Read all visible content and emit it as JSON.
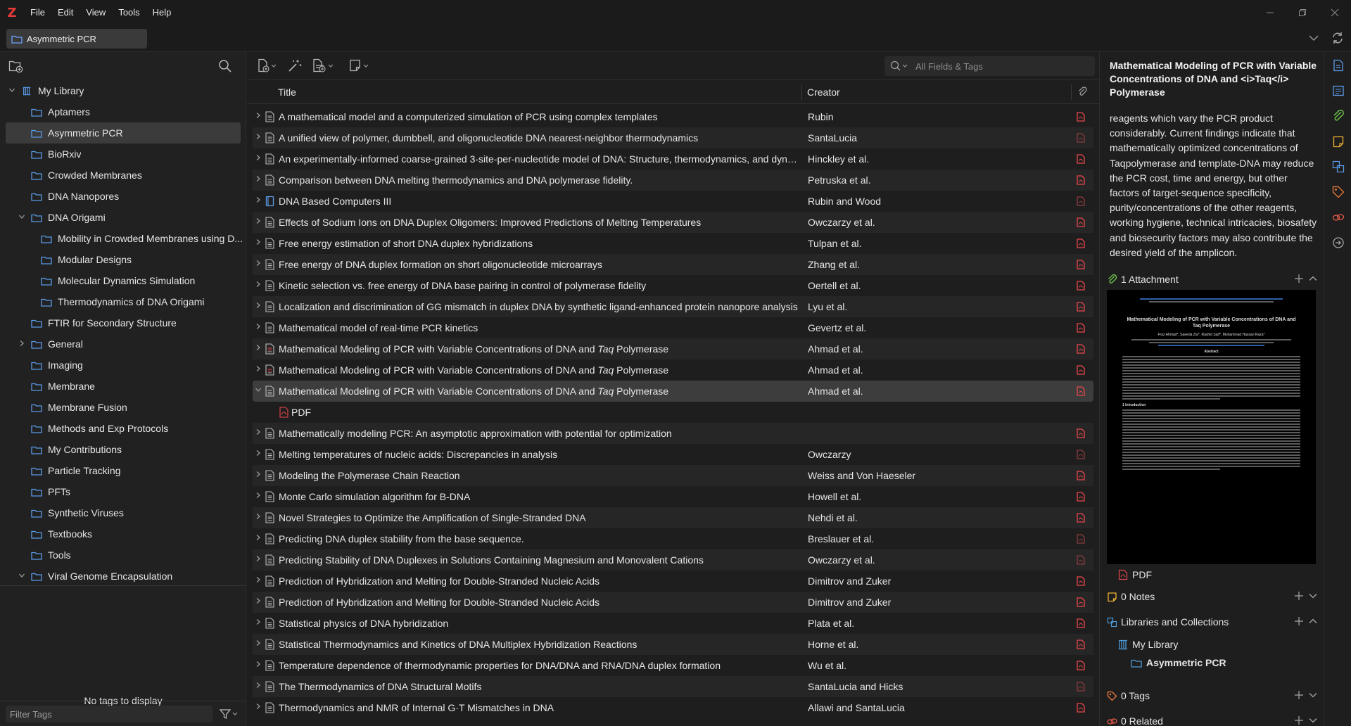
{
  "app": {
    "logo_letter": "Z",
    "accent": "#e83a3a"
  },
  "menu": [
    "File",
    "Edit",
    "View",
    "Tools",
    "Help"
  ],
  "tab": {
    "label": "Asymmetric PCR"
  },
  "collections": [
    {
      "label": "My Library",
      "level": 0,
      "twisty": "open",
      "type": "library"
    },
    {
      "label": "Aptamers",
      "level": 1,
      "twisty": "",
      "type": "folder"
    },
    {
      "label": "Asymmetric PCR",
      "level": 1,
      "twisty": "",
      "type": "folder",
      "selected": true
    },
    {
      "label": "BioRxiv",
      "level": 1,
      "twisty": "",
      "type": "folder"
    },
    {
      "label": "Crowded Membranes",
      "level": 1,
      "twisty": "",
      "type": "folder"
    },
    {
      "label": "DNA Nanopores",
      "level": 1,
      "twisty": "",
      "type": "folder"
    },
    {
      "label": "DNA Origami",
      "level": 1,
      "twisty": "open",
      "type": "folder"
    },
    {
      "label": "Mobility in Crowded Membranes using D...",
      "level": 2,
      "twisty": "",
      "type": "folder"
    },
    {
      "label": "Modular Designs",
      "level": 2,
      "twisty": "",
      "type": "folder"
    },
    {
      "label": "Molecular Dynamics Simulation",
      "level": 2,
      "twisty": "",
      "type": "folder"
    },
    {
      "label": "Thermodynamics of DNA Origami",
      "level": 2,
      "twisty": "",
      "type": "folder"
    },
    {
      "label": "FTIR for Secondary Structure",
      "level": 1,
      "twisty": "",
      "type": "folder"
    },
    {
      "label": "General",
      "level": 1,
      "twisty": "closed",
      "type": "folder"
    },
    {
      "label": "Imaging",
      "level": 1,
      "twisty": "",
      "type": "folder"
    },
    {
      "label": "Membrane",
      "level": 1,
      "twisty": "",
      "type": "folder"
    },
    {
      "label": "Membrane Fusion",
      "level": 1,
      "twisty": "",
      "type": "folder"
    },
    {
      "label": "Methods and Exp Protocols",
      "level": 1,
      "twisty": "",
      "type": "folder"
    },
    {
      "label": "My Contributions",
      "level": 1,
      "twisty": "",
      "type": "folder"
    },
    {
      "label": "Particle Tracking",
      "level": 1,
      "twisty": "",
      "type": "folder"
    },
    {
      "label": "PFTs",
      "level": 1,
      "twisty": "",
      "type": "folder"
    },
    {
      "label": "Synthetic Viruses",
      "level": 1,
      "twisty": "",
      "type": "folder"
    },
    {
      "label": "Textbooks",
      "level": 1,
      "twisty": "",
      "type": "folder"
    },
    {
      "label": "Tools",
      "level": 1,
      "twisty": "",
      "type": "folder"
    },
    {
      "label": "Viral Genome Encapsulation",
      "level": 1,
      "twisty": "open",
      "type": "folder"
    }
  ],
  "tags": {
    "empty_text": "No tags to display",
    "filter_placeholder": "Filter Tags"
  },
  "search": {
    "placeholder": "All Fields & Tags"
  },
  "columns": {
    "title": "Title",
    "creator": "Creator"
  },
  "items": [
    {
      "title": "A mathematical model and a computerized simulation of PCR using complex templates",
      "creator": "Rubin",
      "icon": "doc",
      "attach": "pdf"
    },
    {
      "title": "A unified view of polymer, dumbbell, and oligonucleotide DNA nearest-neighbor thermodynamics",
      "creator": "SantaLucia",
      "icon": "doc",
      "attach": "pdf-dim"
    },
    {
      "title": "An experimentally-informed coarse-grained 3-site-per-nucleotide model of DNA: Structure, thermodynamics, and dyna...",
      "creator": "Hinckley et al.",
      "icon": "doc",
      "attach": "pdf"
    },
    {
      "title": "Comparison between DNA melting thermodynamics and DNA polymerase fidelity.",
      "creator": "Petruska et al.",
      "icon": "doc",
      "attach": "pdf"
    },
    {
      "title": "DNA Based Computers III",
      "creator": "Rubin and Wood",
      "icon": "book",
      "attach": "pdf-dim"
    },
    {
      "title": "Effects of Sodium Ions on DNA Duplex Oligomers: Improved Predictions of Melting Temperatures",
      "creator": "Owczarzy et al.",
      "icon": "doc",
      "attach": "pdf"
    },
    {
      "title": "Free energy estimation of short DNA duplex hybridizations",
      "creator": "Tulpan et al.",
      "icon": "doc",
      "attach": "pdf"
    },
    {
      "title": "Free energy of DNA duplex formation on short oligonucleotide microarrays",
      "creator": "Zhang et al.",
      "icon": "doc",
      "attach": "pdf"
    },
    {
      "title": "Kinetic selection vs. free energy of DNA base pairing in control of polymerase fidelity",
      "creator": "Oertell et al.",
      "icon": "doc",
      "attach": "pdf"
    },
    {
      "title": "Localization and discrimination of GG mismatch in duplex DNA by synthetic ligand-enhanced protein nanopore analysis",
      "creator": "Lyu et al.",
      "icon": "doc",
      "attach": "pdf"
    },
    {
      "title": "Mathematical model of real-time PCR kinetics",
      "creator": "Gevertz et al.",
      "icon": "doc",
      "attach": "pdf"
    },
    {
      "title_pre": "Mathematical Modeling of PCR with Variable Concentrations of DNA and ",
      "title_em": "Taq",
      "title_post": " Polymerase",
      "creator": "Ahmad et al.",
      "icon": "preprint",
      "attach": "pdf"
    },
    {
      "title_pre": "Mathematical Modeling of PCR with Variable Concentrations of DNA and ",
      "title_em": "Taq",
      "title_post": " Polymerase",
      "creator": "Ahmad et al.",
      "icon": "preprint",
      "attach": "pdf"
    },
    {
      "title_pre": "Mathematical Modeling of PCR with Variable Concentrations of DNA and ",
      "title_em": "Taq",
      "title_post": " Polymerase",
      "creator": "Ahmad et al.",
      "icon": "doc",
      "attach": "pdf",
      "selected": true,
      "open": true
    },
    {
      "title": "PDF",
      "creator": "",
      "icon": "pdf",
      "attach": "",
      "child": true
    },
    {
      "title": "Mathematically modeling PCR: An asymptotic approximation with potential for optimization",
      "creator": "",
      "icon": "doc",
      "attach": "pdf"
    },
    {
      "title": "Melting temperatures of nucleic acids: Discrepancies in analysis",
      "creator": "Owczarzy",
      "icon": "doc",
      "attach": "pdf-dim"
    },
    {
      "title": "Modeling the Polymerase Chain Reaction",
      "creator": "Weiss and Von Haeseler",
      "icon": "doc",
      "attach": "pdf"
    },
    {
      "title": "Monte Carlo simulation algorithm for B-DNA",
      "creator": "Howell et al.",
      "icon": "doc",
      "attach": "pdf"
    },
    {
      "title": "Novel Strategies to Optimize the Amplification of Single-Stranded DNA",
      "creator": "Nehdi et al.",
      "icon": "doc",
      "attach": "pdf"
    },
    {
      "title": "Predicting DNA duplex stability from the base sequence.",
      "creator": "Breslauer et al.",
      "icon": "doc",
      "attach": "pdf-dim"
    },
    {
      "title": "Predicting Stability of DNA Duplexes in Solutions Containing Magnesium and Monovalent Cations",
      "creator": "Owczarzy et al.",
      "icon": "doc",
      "attach": "pdf-dim"
    },
    {
      "title": "Prediction of Hybridization and Melting for Double-Stranded Nucleic Acids",
      "creator": "Dimitrov and Zuker",
      "icon": "doc",
      "attach": "pdf"
    },
    {
      "title": "Prediction of Hybridization and Melting for Double-Stranded Nucleic Acids",
      "creator": "Dimitrov and Zuker",
      "icon": "doc",
      "attach": "pdf"
    },
    {
      "title": "Statistical physics of DNA hybridization",
      "creator": "Plata et al.",
      "icon": "doc",
      "attach": "pdf"
    },
    {
      "title": "Statistical Thermodynamics and Kinetics of DNA Multiplex Hybridization Reactions",
      "creator": "Horne et al.",
      "icon": "doc",
      "attach": "pdf"
    },
    {
      "title": "Temperature dependence of thermodynamic properties for DNA/DNA and RNA/DNA duplex formation",
      "creator": "Wu et al.",
      "icon": "doc",
      "attach": "pdf"
    },
    {
      "title": "The Thermodynamics of DNA Structural Motifs",
      "creator": "SantaLucia and Hicks",
      "icon": "doc",
      "attach": "pdf-dim"
    },
    {
      "title": "Thermodynamics and NMR of Internal G·T Mismatches in DNA",
      "creator": "Allawi and SantaLucia",
      "icon": "doc",
      "attach": "pdf"
    }
  ],
  "item_pane": {
    "title": "Mathematical Modeling of PCR with Variable Concentrations of DNA and <i>Taq</i> Polymerase",
    "abstract": "reagents which vary the PCR product considerably. Current findings indicate that mathematically optimized concentrations of Taqpolymerase and template-DNA may reduce the PCR cost, time and energy, but other factors of target-sequence specificity, purity/concentrations of the other reagents, working hygiene, technical intricacies, biosafety and biosecurity factors may also contribute the desired yield of the amplicon.",
    "attachments_header": "1 Attachment",
    "attachment_label": "PDF",
    "notes_header": "0 Notes",
    "libraries_header": "Libraries and Collections",
    "library": "My Library",
    "collection": "Asymmetric PCR",
    "tags_header": "0 Tags",
    "related_header": "0 Related"
  },
  "pdf_preview": {
    "title": "Mathematical Modeling of PCR with Variable Concentrations of DNA and Taq Polymerase",
    "authors": "Fraz Ahmad*, Saeeda Zia*, Rashid Saif*, Muhammad Hassan Raza*",
    "abstract_heading": "Abstract",
    "intro_heading": "1 Introduction"
  }
}
